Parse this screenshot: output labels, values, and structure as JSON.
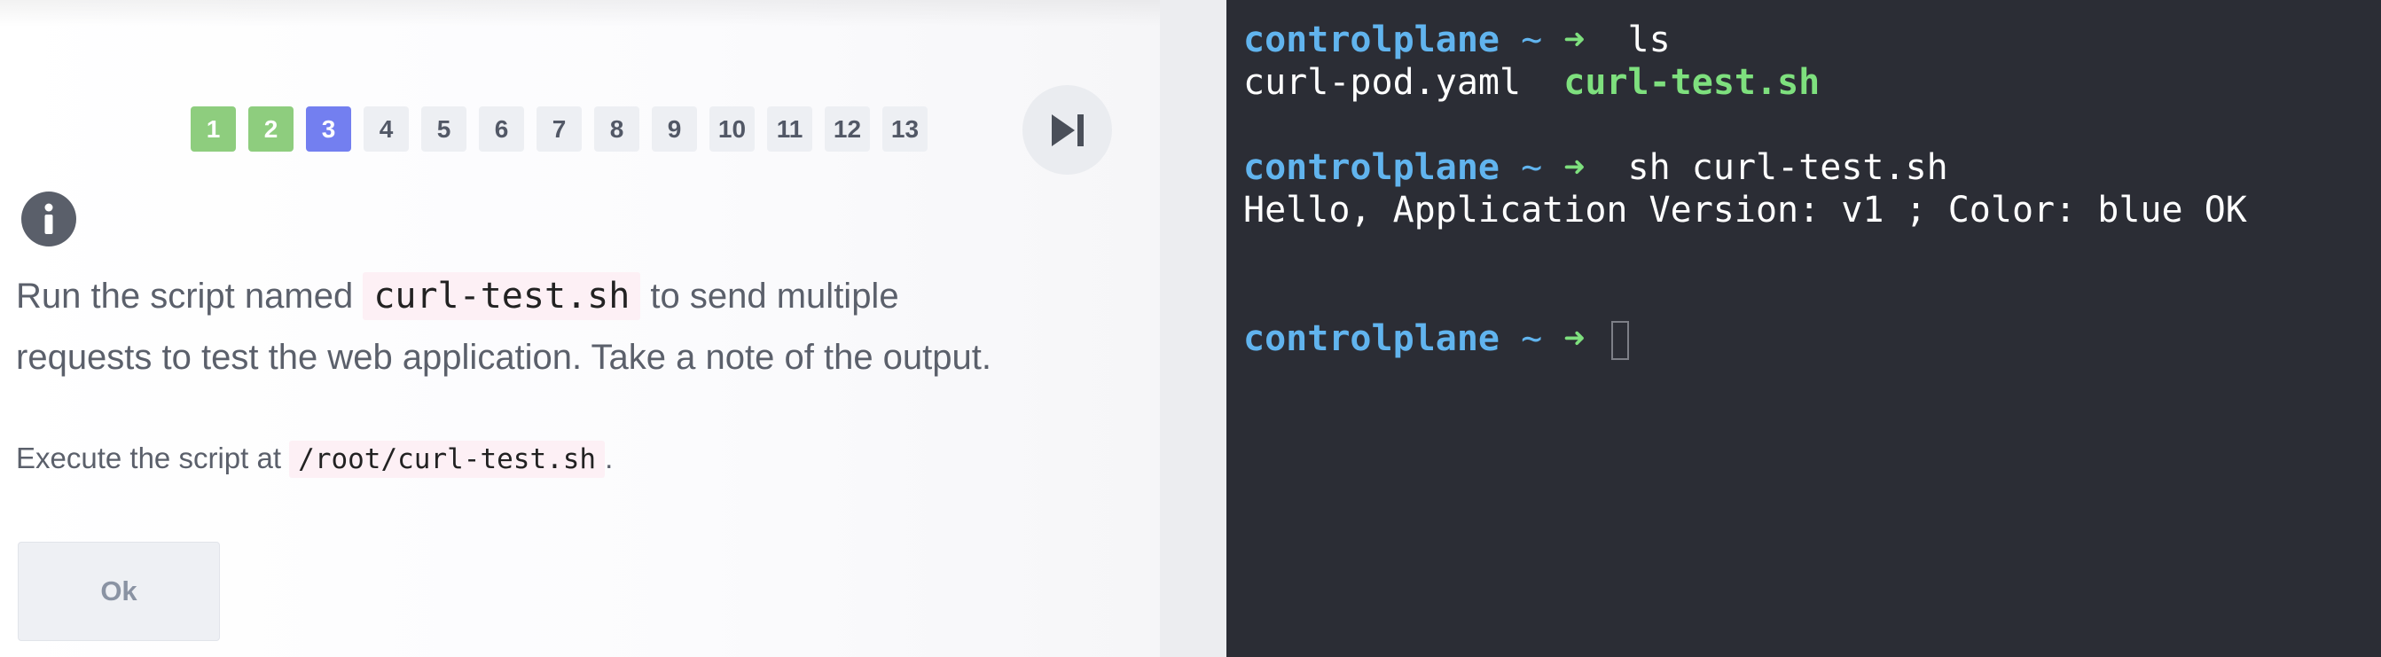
{
  "pager": {
    "pages": [
      {
        "label": "1",
        "state": "done"
      },
      {
        "label": "2",
        "state": "done"
      },
      {
        "label": "3",
        "state": "current"
      },
      {
        "label": "4",
        "state": "todo"
      },
      {
        "label": "5",
        "state": "todo"
      },
      {
        "label": "6",
        "state": "todo"
      },
      {
        "label": "7",
        "state": "todo"
      },
      {
        "label": "8",
        "state": "todo"
      },
      {
        "label": "9",
        "state": "todo"
      },
      {
        "label": "10",
        "state": "todo"
      },
      {
        "label": "11",
        "state": "todo"
      },
      {
        "label": "12",
        "state": "todo"
      },
      {
        "label": "13",
        "state": "todo"
      }
    ],
    "skip_icon": "skip-next-icon"
  },
  "question": {
    "info_icon": "info-icon",
    "line1_before": "Run the script named ",
    "line1_code": "curl-test.sh",
    "line1_after": " to send multiple",
    "line2": "requests to test the web application. Take a note of the output.",
    "exec_before": "Execute the script at ",
    "exec_code": "/root/curl-test.sh",
    "exec_after": "."
  },
  "actions": {
    "ok_label": "Ok"
  },
  "terminal": {
    "prompt_host": "controlplane",
    "prompt_tilde": "~",
    "prompt_arrow": "➜",
    "cmd1": "ls",
    "ls_file1": "curl-pod.yaml",
    "ls_file2": "curl-test.sh",
    "cmd2": "sh curl-test.sh",
    "output": "Hello, Application Version: v1 ; Color: blue OK"
  },
  "colors": {
    "done": "#8ecd7e",
    "current": "#737ff0",
    "terminal_bg": "#2b2d35",
    "prompt_blue": "#61b4ee",
    "prompt_green": "#7ee07e"
  }
}
